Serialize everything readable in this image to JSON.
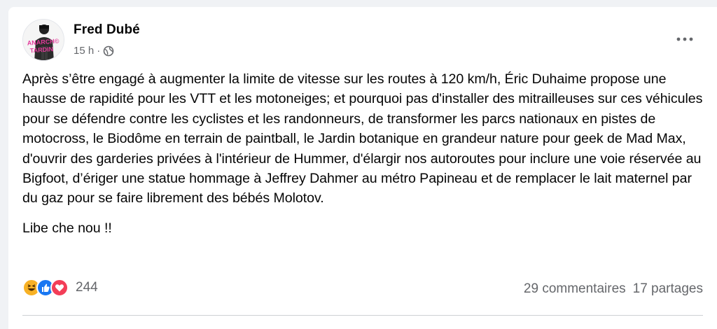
{
  "post": {
    "author": "Fred Dubé",
    "time": "15 h",
    "separator": "·",
    "privacy_icon": "globe-icon",
    "body": [
      "Après s’être engagé à augmenter la limite de vitesse sur les routes à 120 km/h, Éric Duhaime propose une hausse de rapidité pour les VTT et les motoneiges; et pourquoi pas d'installer des mitrailleuses sur ces véhicules pour se défendre contre les cyclistes et les randonneurs, de transformer les parcs nationaux en pistes de motocross, le Biodôme en terrain de paintball, le Jardin botanique en grandeur nature pour geek de Mad Max, d'ouvrir des garderies privées à l'intérieur de Hummer, d'élargir nos autoroutes pour inclure une voie réservée au Bigfoot, d’ériger une statue hommage à Jeffrey Dahmer au métro Papineau et de remplacer le lait maternel par du gaz pour se faire librement des bébés Molotov.",
      "Libe che nou !!"
    ],
    "avatar_text": "ANARCHO TARDIN"
  },
  "reactions": {
    "icons": [
      "haha-icon",
      "like-icon",
      "love-icon"
    ],
    "count": "244"
  },
  "stats": {
    "comments": "29 commentaires",
    "shares": "17 partages"
  },
  "colors": {
    "like": "#1877f2",
    "love": "#f33e58",
    "haha": "#f7b125",
    "secondary_text": "#65676b"
  }
}
